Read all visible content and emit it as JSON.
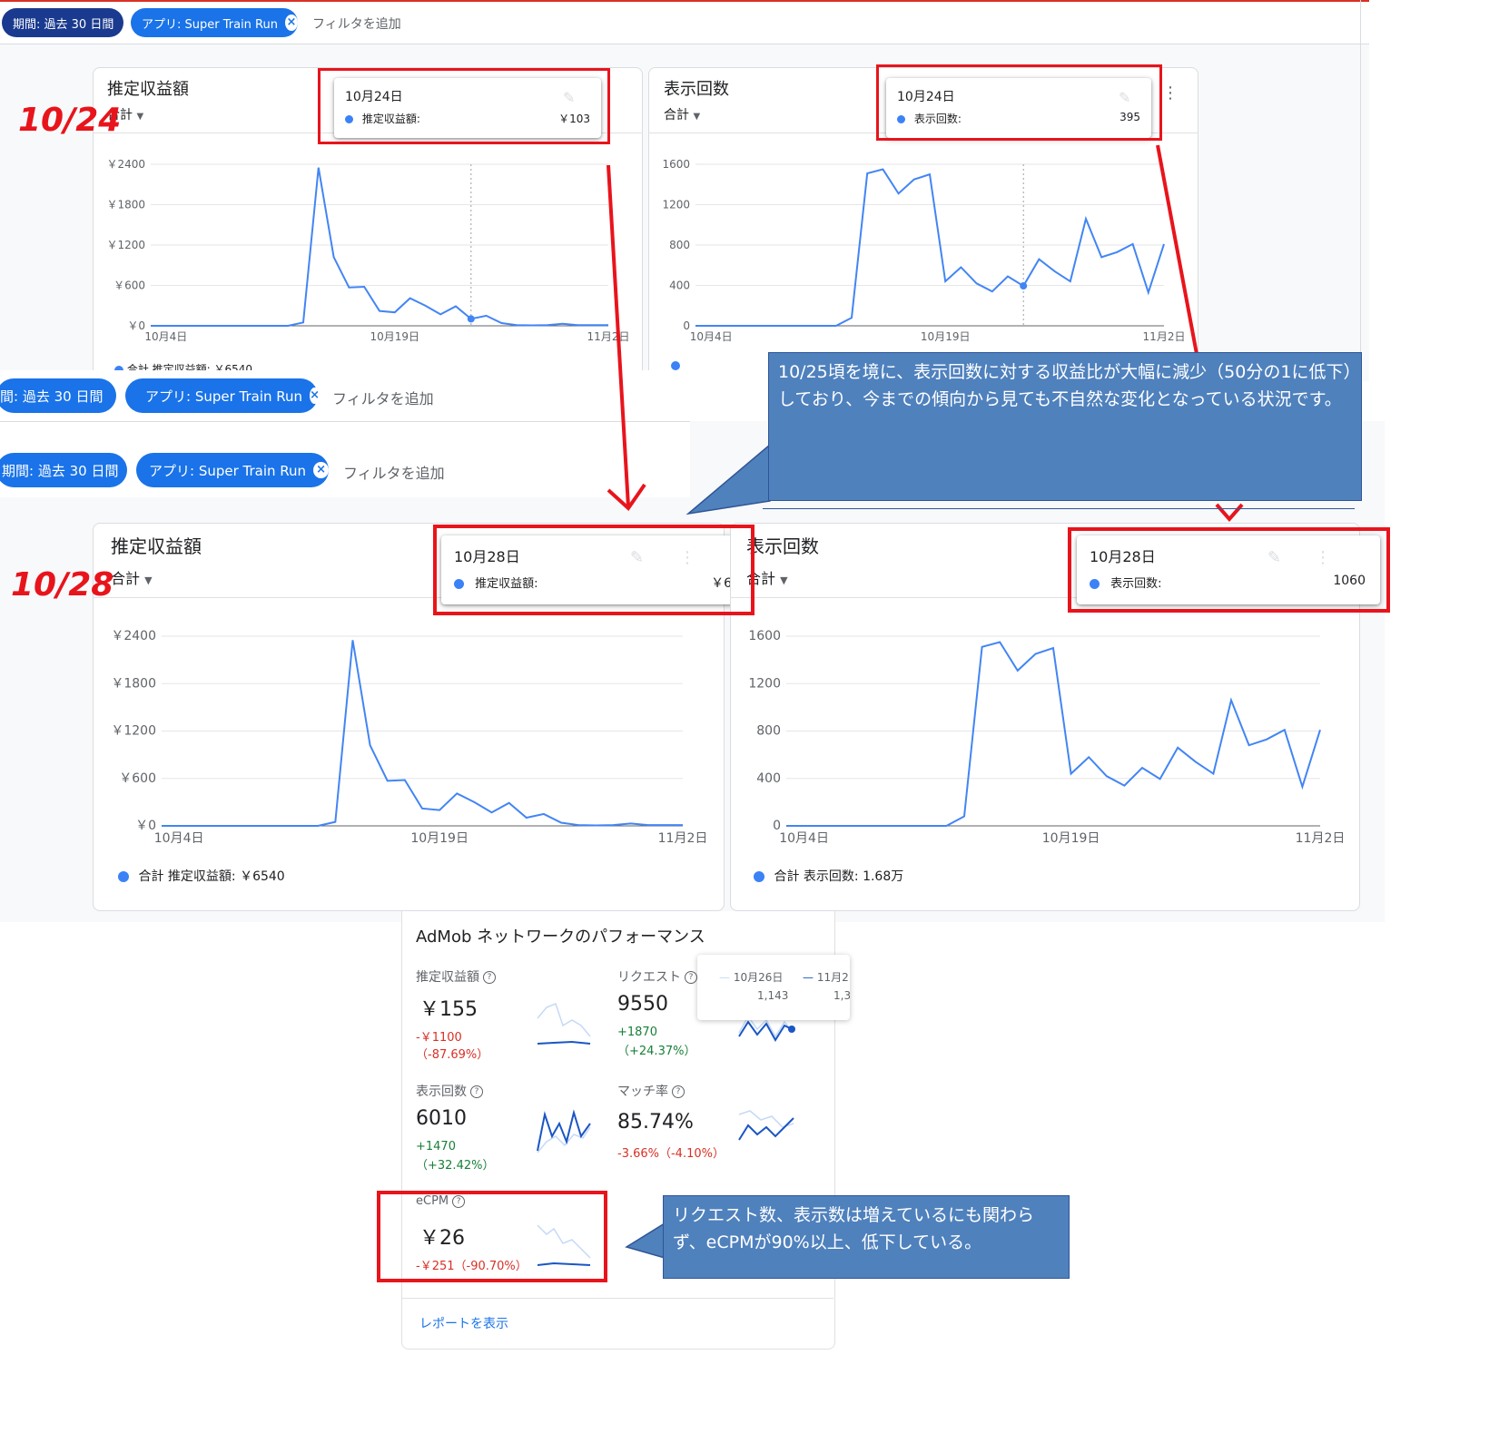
{
  "filters": {
    "period": "期間: 過去 30 日間",
    "period_cut": "間: 過去 30 日間",
    "period_cut2": "期間: 過去 30 日間",
    "app": "アプリ: Super Train Run",
    "add": "フィルタを追加"
  },
  "labels": {
    "date_1024": "10/24",
    "date_1028": "10/28"
  },
  "top": {
    "revenue": {
      "title": "推定収益額",
      "agg": "合計",
      "tooltip": {
        "date": "10月24日",
        "metric": "推定収益額:",
        "value": "￥103"
      },
      "legend": "合計 推定収益額: ￥6540",
      "y_ticks": [
        "￥2400",
        "￥1800",
        "￥1200",
        "￥600",
        "￥0"
      ],
      "x_ticks": [
        "10月4日",
        "10月19日",
        "11月2日"
      ]
    },
    "impressions": {
      "title": "表示回数",
      "agg": "合計",
      "tooltip": {
        "date": "10月24日",
        "metric": "表示回数:",
        "value": "395"
      },
      "y_ticks": [
        "1600",
        "1200",
        "800",
        "400",
        "0"
      ],
      "x_ticks": [
        "10月4日",
        "10月19日",
        "11月2日"
      ]
    }
  },
  "bottom": {
    "revenue": {
      "title": "推定収益額",
      "agg": "合計",
      "tooltip": {
        "date": "10月28日",
        "metric": "推定収益額:",
        "value": "￥6"
      },
      "legend": "合計 推定収益額: ￥6540",
      "y_ticks": [
        "￥2400",
        "￥1800",
        "￥1200",
        "￥600",
        "￥0"
      ],
      "x_ticks": [
        "10月4日",
        "10月19日",
        "11月2日"
      ]
    },
    "impressions": {
      "title": "表示回数",
      "agg": "合計",
      "tooltip": {
        "date": "10月28日",
        "metric": "表示回数:",
        "value": "1060"
      },
      "legend": "合計 表示回数: 1.68万",
      "y_ticks": [
        "1600",
        "1200",
        "800",
        "400",
        "0"
      ],
      "x_ticks": [
        "10月4日",
        "10月19日",
        "11月2日"
      ]
    }
  },
  "callouts": {
    "ratio": "10/25頃を境に、表示回数に対する収益比が大幅に減少（50分の1に低下）しており、今までの傾向から見ても不自然な変化となっている状況です。",
    "ecpm": "リクエスト数、表示数は増えているにも関わらず、eCPMが90%以上、低下している。"
  },
  "admob": {
    "title": "AdMob ネットワークのパフォーマンス",
    "revenue": {
      "label": "推定収益額",
      "value": "￥155",
      "change": "-￥1100",
      "pct": "（-87.69%）"
    },
    "requests": {
      "label": "リクエスト",
      "value": "9550",
      "change": "+1870",
      "pct": "（+24.37%）"
    },
    "impressions": {
      "label": "表示回数",
      "value": "6010",
      "change": "+1470",
      "pct": "（+32.42%）"
    },
    "match": {
      "label": "マッチ率",
      "value": "85.74%",
      "change": "-3.66%（-4.10%）"
    },
    "ecpm": {
      "label": "eCPM",
      "value": "￥26",
      "change": "-￥251（-90.70%）"
    },
    "mini_tooltip": {
      "d1": "10月26日",
      "v1": "1,143",
      "d2": "11月2",
      "v2": "1,3"
    },
    "report_link": "レポートを表示"
  },
  "colors": {
    "line": "#4285f4",
    "chip_dark": "#1a3a8f",
    "chip": "#1a73e8",
    "red": "#e8141c",
    "callout": "#4f81bd"
  },
  "chart_data": [
    {
      "type": "line",
      "title": "推定収益額",
      "categories": [
        "10/3",
        "10/4",
        "10/5",
        "10/6",
        "10/7",
        "10/8",
        "10/9",
        "10/10",
        "10/11",
        "10/12",
        "10/13",
        "10/14",
        "10/15",
        "10/16",
        "10/17",
        "10/18",
        "10/19",
        "10/20",
        "10/21",
        "10/22",
        "10/23",
        "10/24",
        "10/25",
        "10/26",
        "10/27",
        "10/28",
        "10/29",
        "10/30",
        "10/31",
        "11/1",
        "11/2"
      ],
      "values": [
        0,
        0,
        0,
        0,
        0,
        0,
        0,
        0,
        0,
        0,
        50,
        2350,
        1020,
        570,
        580,
        220,
        200,
        410,
        300,
        170,
        290,
        103,
        150,
        40,
        10,
        6,
        10,
        30,
        10,
        10,
        10
      ],
      "ylim": [
        0,
        2400
      ]
    },
    {
      "type": "line",
      "title": "表示回数",
      "categories": [
        "10/3",
        "10/4",
        "10/5",
        "10/6",
        "10/7",
        "10/8",
        "10/9",
        "10/10",
        "10/11",
        "10/12",
        "10/13",
        "10/14",
        "10/15",
        "10/16",
        "10/17",
        "10/18",
        "10/19",
        "10/20",
        "10/21",
        "10/22",
        "10/23",
        "10/24",
        "10/25",
        "10/26",
        "10/27",
        "10/28",
        "10/29",
        "10/30",
        "10/31",
        "11/1",
        "11/2"
      ],
      "values": [
        0,
        0,
        0,
        0,
        0,
        0,
        0,
        0,
        0,
        0,
        80,
        1510,
        1550,
        1310,
        1450,
        1500,
        440,
        580,
        420,
        340,
        490,
        395,
        660,
        540,
        440,
        1060,
        680,
        730,
        810,
        330,
        810
      ],
      "ylim": [
        0,
        1600
      ]
    }
  ]
}
